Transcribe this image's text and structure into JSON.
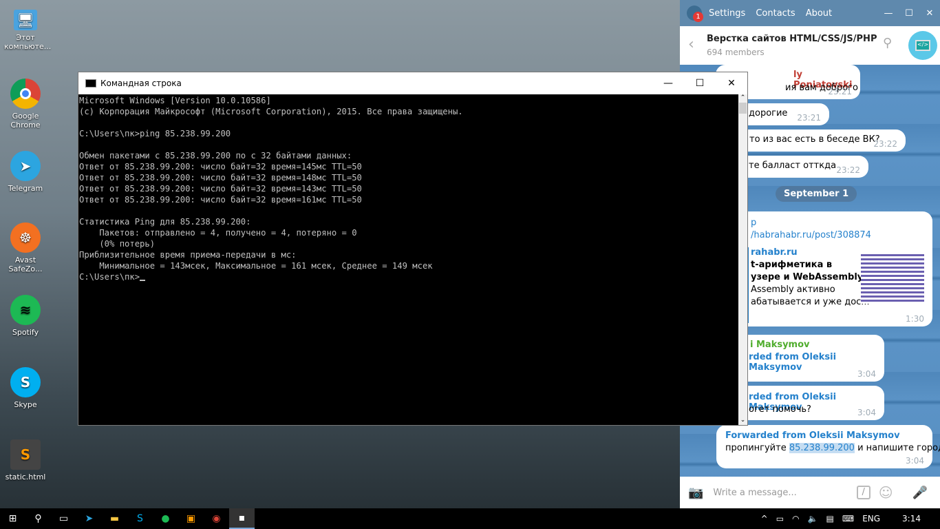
{
  "desktop": {
    "icons": [
      {
        "label": "Этот компьюте...",
        "icon": "computer-icon",
        "color": "#4aa3df"
      },
      {
        "label": "Google Chrome",
        "icon": "chrome-icon",
        "color": "#db4437"
      },
      {
        "label": "Telegram",
        "icon": "telegram-icon",
        "color": "#2ca5e0"
      },
      {
        "label": "Avast SafeZo...",
        "icon": "avast-icon",
        "color": "#f37021"
      },
      {
        "label": "Spotify",
        "icon": "spotify-icon",
        "color": "#1db954"
      },
      {
        "label": "Skype",
        "icon": "skype-icon",
        "color": "#00aff0"
      },
      {
        "label": "static.html",
        "icon": "sublime-icon",
        "color": "#444444"
      }
    ]
  },
  "cmd": {
    "title": "Командная строка",
    "lines": "Microsoft Windows [Version 10.0.10586]\n(c) Корпорация Майкрософт (Microsoft Corporation), 2015. Все права защищены.\n\nC:\\Users\\пк>ping 85.238.99.200\n\nОбмен пакетами с 85.238.99.200 по с 32 байтами данных:\nОтвет от 85.238.99.200: число байт=32 время=145мс TTL=50\nОтвет от 85.238.99.200: число байт=32 время=148мс TTL=50\nОтвет от 85.238.99.200: число байт=32 время=143мс TTL=50\nОтвет от 85.238.99.200: число байт=32 время=161мс TTL=50\n\nСтатистика Ping для 85.238.99.200:\n    Пакетов: отправлено = 4, получено = 4, потеряно = 0\n    (0% потерь)\nПриблизительное время приема-передачи в мс:\n    Минимальное = 143мсек, Максимальное = 161 мсек, Среднее = 149 мсек\n",
    "prompt": "C:\\Users\\пк>"
  },
  "telegram": {
    "badge": "1",
    "menu": [
      "Settings",
      "Contacts",
      "About"
    ],
    "chat_title": "Верстка сайтов HTML/CSS/JS/PHP",
    "members": "694 members",
    "messages": [
      {
        "author": "ly Poniatovski",
        "text": "ия вам доброго",
        "time": "23:21"
      },
      {
        "text": "дорогие",
        "time": "23:21"
      },
      {
        "text": "то из вас есть в беседе ВК?",
        "time": "23:22"
      },
      {
        "text": "те балласт отткда",
        "time": "23:22"
      }
    ],
    "date": "September 1",
    "link": {
      "label": "p",
      "url": "/habrahabr.ru/post/308874",
      "site": "rahabr.ru",
      "title1": "t-арифметика в",
      "title2": "узере и WebAssembly",
      "desc1": "Assembly активно",
      "desc2": "абатывается и уже дос...",
      "time": "1:30"
    },
    "fwd1": {
      "author": "i Maksymov",
      "fwd": "rded from Oleksii Maksymov",
      "time": "3:04"
    },
    "fwd2": {
      "fwd": "rded from Oleksii Maksymov",
      "text": "огет помочь?",
      "time": "3:04"
    },
    "fwd3": {
      "fwd": "Forwarded from Oleksii Maksymov",
      "text_a": "пропингуйте ",
      "ip": "85.238.99.200",
      "text_b": " и напишите город",
      "time": "3:04"
    },
    "placeholder": "Write a message..."
  },
  "taskbar": {
    "lang": "ENG",
    "time": "3:14"
  }
}
